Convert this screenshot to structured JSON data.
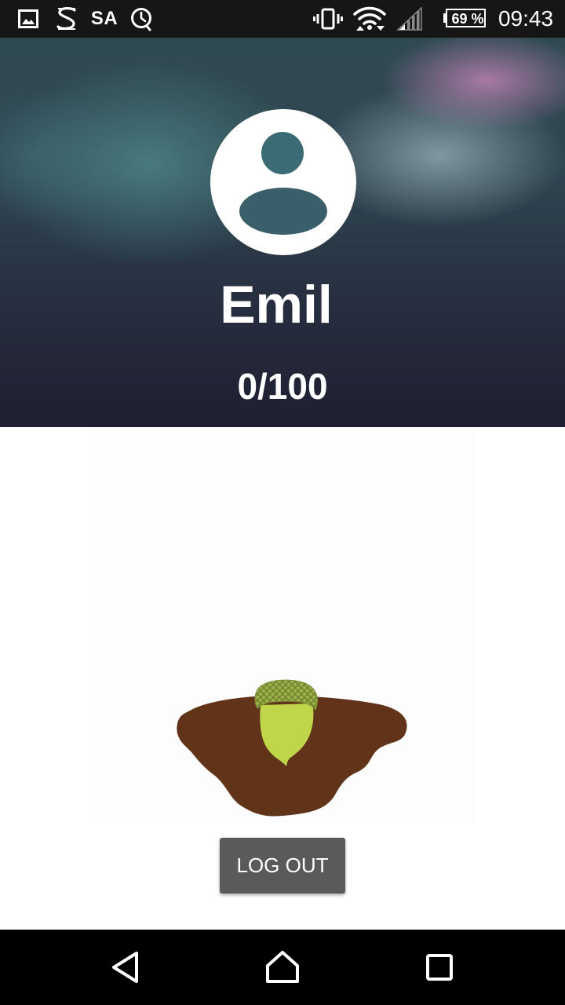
{
  "status_bar": {
    "carrier_text": "SA",
    "battery_percent": "69 %",
    "time": "09:43",
    "icons": [
      "gallery-icon",
      "s-app-icon",
      "alarm-icon",
      "vibrate-icon",
      "wifi-icon",
      "signal-icon",
      "battery-icon"
    ]
  },
  "profile": {
    "name": "Emil",
    "score": "0/100"
  },
  "actions": {
    "logout_label": "LOG OUT"
  },
  "nav_bar": {
    "icons": [
      "back-icon",
      "home-icon",
      "recents-icon"
    ]
  },
  "colors": {
    "status_bar_bg": "#161616",
    "header_dark": "#1e1f30",
    "soil": "#61341a",
    "acorn_body": "#bfd54a",
    "acorn_cap": "#8a9a3c",
    "button_bg": "#5a5a5a",
    "nav_bar_bg": "#000000"
  }
}
